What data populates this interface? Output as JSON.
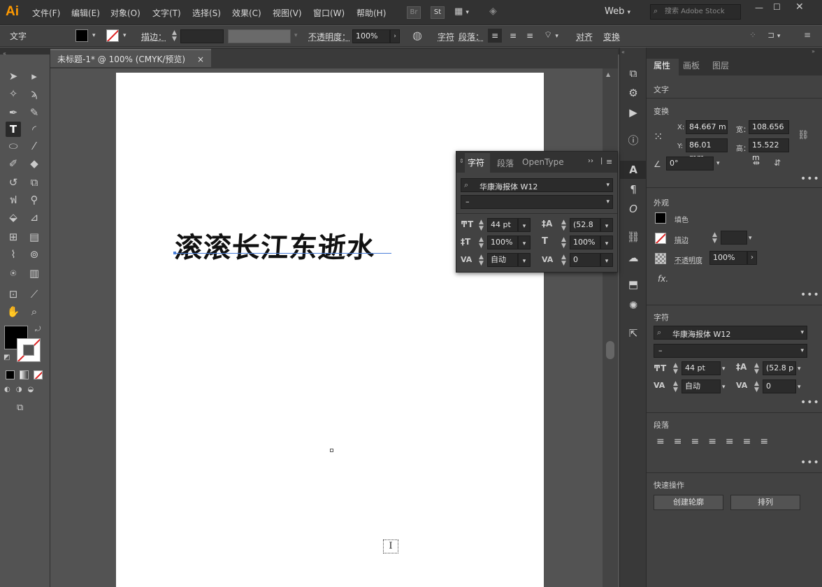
{
  "app": {
    "logo": "Ai",
    "workspace": "Web",
    "stock_placeholder": "搜索 Adobe Stock",
    "br": "Br",
    "st": "St"
  },
  "menu": [
    "文件(F)",
    "编辑(E)",
    "对象(O)",
    "文字(T)",
    "选择(S)",
    "效果(C)",
    "视图(V)",
    "窗口(W)",
    "帮助(H)"
  ],
  "control_bar": {
    "selection_type": "文字",
    "stroke_label": "描边：",
    "opacity_label": "不透明度：",
    "opacity_value": "100%",
    "char_label": "字符",
    "para_label": "段落：",
    "align_label": "对齐",
    "transform_label": "变换"
  },
  "document": {
    "tab_title": "未标题-1* @ 100% (CMYK/预览)",
    "close": "×",
    "text": "滚滚长江东逝水"
  },
  "char_panel": {
    "tabs": [
      "字符",
      "段落",
      "OpenType"
    ],
    "font_family": "华康海报体 W12",
    "font_style": "–",
    "size": "44 pt",
    "leading": "(52.8 p",
    "vscale": "100%",
    "hscale": "100%",
    "kerning": "自动",
    "tracking": "0"
  },
  "right_panel": {
    "tabs": [
      "属性",
      "画板",
      "图层"
    ],
    "selection": "文字",
    "transform": {
      "title": "变换",
      "x_label": "X:",
      "x": "84.667 m",
      "y_label": "Y:",
      "y": "86.01 mm",
      "w_label": "宽：",
      "w": "108.656",
      "h_label": "高：",
      "h": "15.522 m",
      "angle": "0°"
    },
    "appearance": {
      "title": "外观",
      "fill": "填色",
      "stroke": "描边",
      "opacity_label": "不透明度",
      "opacity": "100%",
      "fx": "fx."
    },
    "character": {
      "title": "字符",
      "font_family": "华康海报体 W12",
      "font_style": "–",
      "size": "44 pt",
      "leading": "(52.8 p",
      "kerning": "自动",
      "tracking": "0"
    },
    "paragraph": {
      "title": "段落"
    },
    "quick_actions": {
      "title": "快速操作",
      "create_outlines": "创建轮廓",
      "arrange": "排列"
    }
  },
  "colors": {
    "chrome_dark": "#323232",
    "panel": "#424242",
    "canvas": "#535353",
    "artboard": "#ffffff",
    "accent_orange": "#ff9a00",
    "text_selection_line": "#4a7fd8"
  }
}
